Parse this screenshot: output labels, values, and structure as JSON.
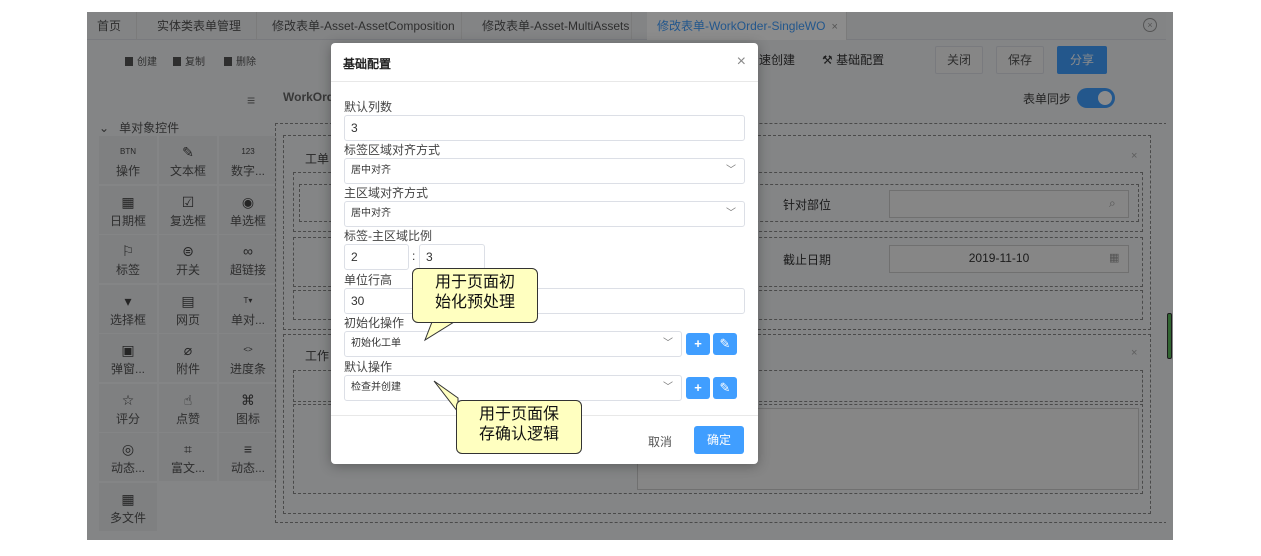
{
  "tabs": [
    {
      "label": "首页",
      "active": false
    },
    {
      "label": "实体类表单管理",
      "active": false
    },
    {
      "label": "修改表单-Asset-AssetComposition",
      "active": false
    },
    {
      "label": "修改表单-Asset-MultiAssets",
      "active": false
    },
    {
      "label": "修改表单-WorkOrder-SingleWO",
      "active": true,
      "close": "×"
    }
  ],
  "toolbar": {
    "create": "创建",
    "copy": "复制",
    "delete": "删除",
    "quick_create": "速创建",
    "basic_config": "基础配置",
    "close": "关闭",
    "save": "保存",
    "share": "分享"
  },
  "canvas": {
    "title": "WorkOrd",
    "sync_label": "表单同步",
    "section1_title": "工单",
    "section2_title": "工作",
    "field1_label": "针对部位",
    "field2_label": "截止日期",
    "field2_value": "2019-11-10"
  },
  "sidebar": {
    "header": "单对象控件",
    "items": [
      {
        "label": "操作",
        "icon": "btn-icon",
        "glyph": "BTN"
      },
      {
        "label": "文本框",
        "icon": "edit-icon",
        "glyph": "✎"
      },
      {
        "label": "数字...",
        "icon": "number-icon",
        "glyph": "123"
      },
      {
        "label": "日期框",
        "icon": "calendar-icon",
        "glyph": "▦"
      },
      {
        "label": "复选框",
        "icon": "checkbox-icon",
        "glyph": "☑"
      },
      {
        "label": "单选框",
        "icon": "radio-icon",
        "glyph": "◉"
      },
      {
        "label": "标签",
        "icon": "bookmark-icon",
        "glyph": "⚐"
      },
      {
        "label": "开关",
        "icon": "switch-icon",
        "glyph": "⊜"
      },
      {
        "label": "超链接",
        "icon": "link-icon",
        "glyph": "∞"
      },
      {
        "label": "选择框",
        "icon": "select-icon",
        "glyph": "▾"
      },
      {
        "label": "网页",
        "icon": "webpage-icon",
        "glyph": "▤"
      },
      {
        "label": "单对...",
        "icon": "single-object-icon",
        "glyph": "T▾"
      },
      {
        "label": "弹窗...",
        "icon": "popup-icon",
        "glyph": "▣"
      },
      {
        "label": "附件",
        "icon": "attachment-icon",
        "glyph": "⌀"
      },
      {
        "label": "进度条",
        "icon": "progress-icon",
        "glyph": "<>"
      },
      {
        "label": "评分",
        "icon": "star-icon",
        "glyph": "☆"
      },
      {
        "label": "点赞",
        "icon": "thumbs-up-icon",
        "glyph": "☝"
      },
      {
        "label": "图标",
        "icon": "icons-icon",
        "glyph": "⌘"
      },
      {
        "label": "动态...",
        "icon": "dynamic-icon",
        "glyph": "◎"
      },
      {
        "label": "富文...",
        "icon": "richtext-icon",
        "glyph": "⌗"
      },
      {
        "label": "动态...",
        "icon": "dynamic-list-icon",
        "glyph": "≡"
      },
      {
        "label": "多文件",
        "icon": "files-icon",
        "glyph": "▦"
      }
    ]
  },
  "modal": {
    "title": "基础配置",
    "close": "×",
    "default_columns_label": "默认列数",
    "default_columns_value": "3",
    "label_align_label": "标签区域对齐方式",
    "label_align_value": "居中对齐",
    "main_align_label": "主区域对齐方式",
    "main_align_value": "居中对齐",
    "ratio_label": "标签-主区域比例",
    "ratio_left": "2",
    "ratio_sep": ":",
    "ratio_right": "3",
    "row_height_label": "单位行高",
    "row_height_value": "30",
    "init_op_label": "初始化操作",
    "init_op_value": "初始化工单",
    "default_op_label": "默认操作",
    "default_op_value": "检查并创建",
    "add": "+",
    "edit": "✎",
    "cancel": "取消",
    "ok": "确定"
  },
  "callouts": {
    "init_note_line1": "用于页面初",
    "init_note_line2": "始化预处理",
    "save_note_line1": "用于页面保",
    "save_note_line2": "存确认逻辑"
  },
  "colors": {
    "accent": "#409eff",
    "callout_bg": "#ffffc0"
  }
}
